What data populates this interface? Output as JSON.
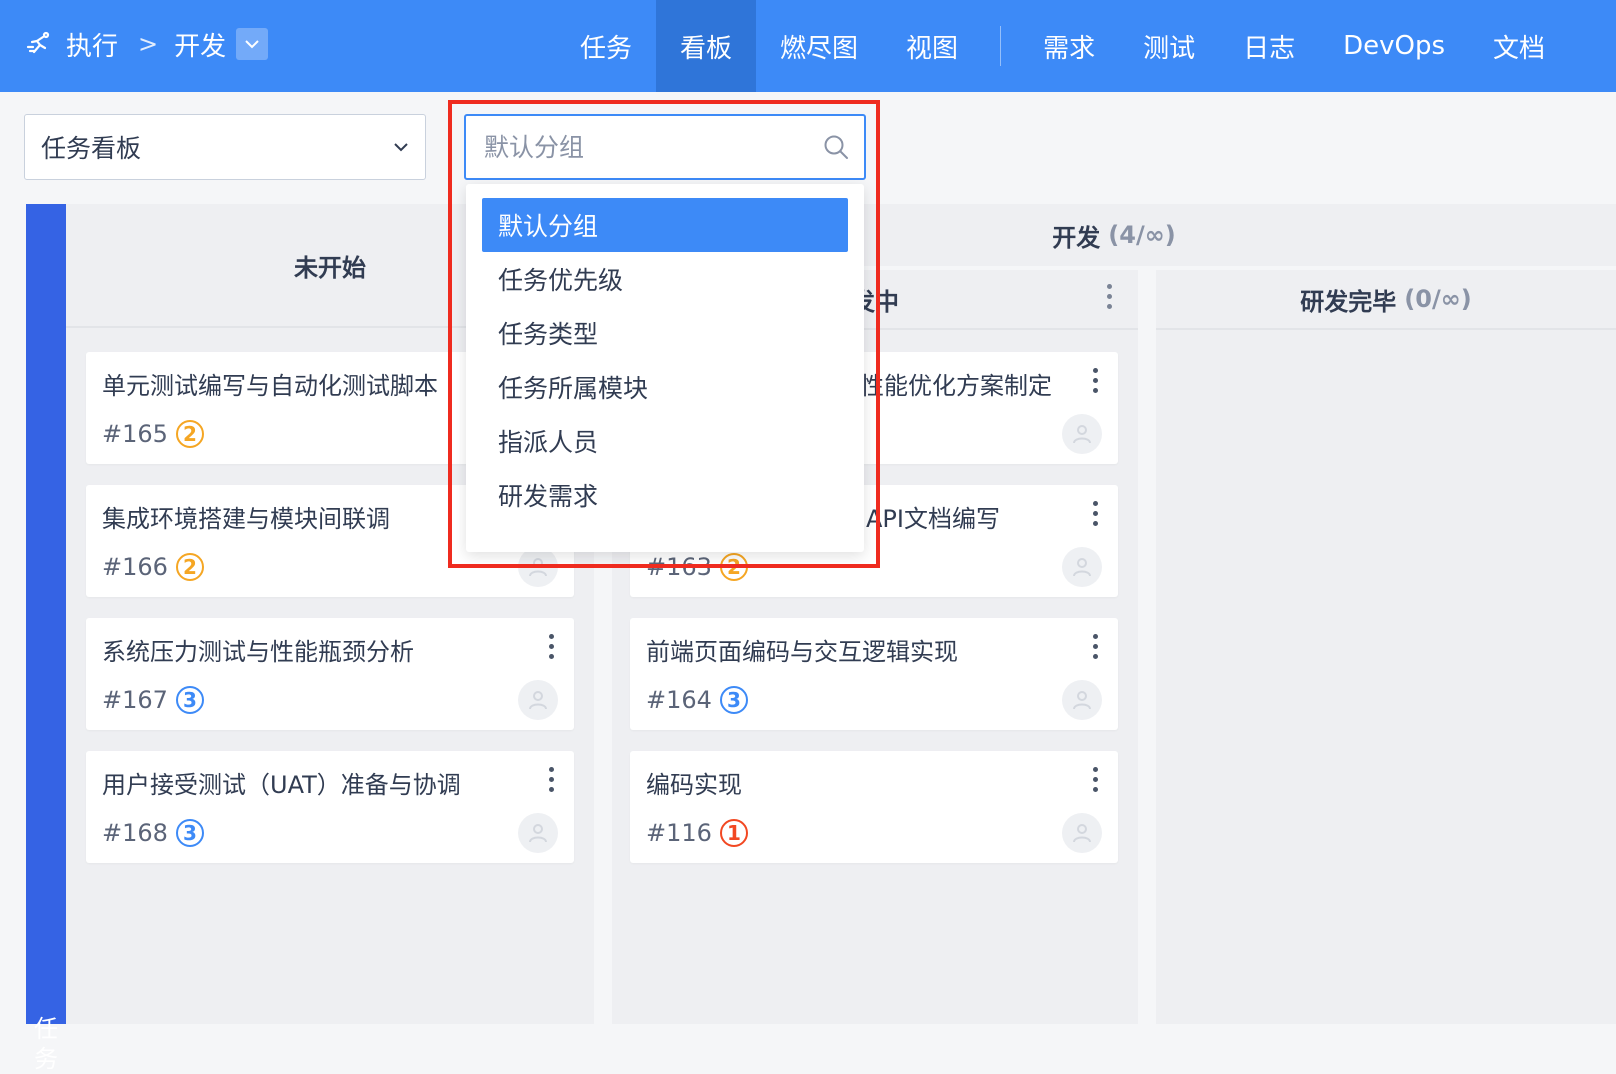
{
  "header": {
    "breadcrumb": {
      "root": "执行",
      "current": "开发"
    },
    "nav": [
      "任务",
      "看板",
      "燃尽图",
      "视图"
    ],
    "nav2": [
      "需求",
      "测试",
      "日志",
      "DevOps",
      "文档"
    ],
    "active_nav": "看板"
  },
  "toolbar": {
    "board_select": "任务看板",
    "group_input_placeholder": "默认分组"
  },
  "dropdown": {
    "options": [
      "默认分组",
      "任务优先级",
      "任务类型",
      "任务所属模块",
      "指派人员",
      "研发需求"
    ],
    "selected": "默认分组"
  },
  "board": {
    "lane": "任务",
    "columns": {
      "not_started": {
        "title": "未开始"
      },
      "group": {
        "title": "开发",
        "count": "(4/∞)"
      },
      "in_dev": {
        "title": "发中"
      },
      "dev_done": {
        "title": "研发完毕",
        "count": "(0/∞)"
      }
    },
    "cards_col1": [
      {
        "title": "单元测试编写与自动化测试脚本",
        "id": "#165",
        "priority": "2"
      },
      {
        "title": "集成环境搭建与模块间联调",
        "id": "#166",
        "priority": "2"
      },
      {
        "title": "系统压力测试与性能瓶颈分析",
        "id": "#167",
        "priority": "3"
      },
      {
        "title": "用户接受测试（UAT）准备与协调",
        "id": "#168",
        "priority": "3"
      }
    ],
    "cards_col2": [
      {
        "title": "性能优化方案制定"
      },
      {
        "title": "API文档编写",
        "id": "#163",
        "priority": "2"
      },
      {
        "title": "前端页面编码与交互逻辑实现",
        "id": "#164",
        "priority": "3"
      },
      {
        "title": "编码实现",
        "id": "#116",
        "priority": "1"
      }
    ]
  },
  "colors": {
    "primary": "#3d8af7",
    "lane": "#3563e4",
    "highlight": "#ef2b1f"
  }
}
